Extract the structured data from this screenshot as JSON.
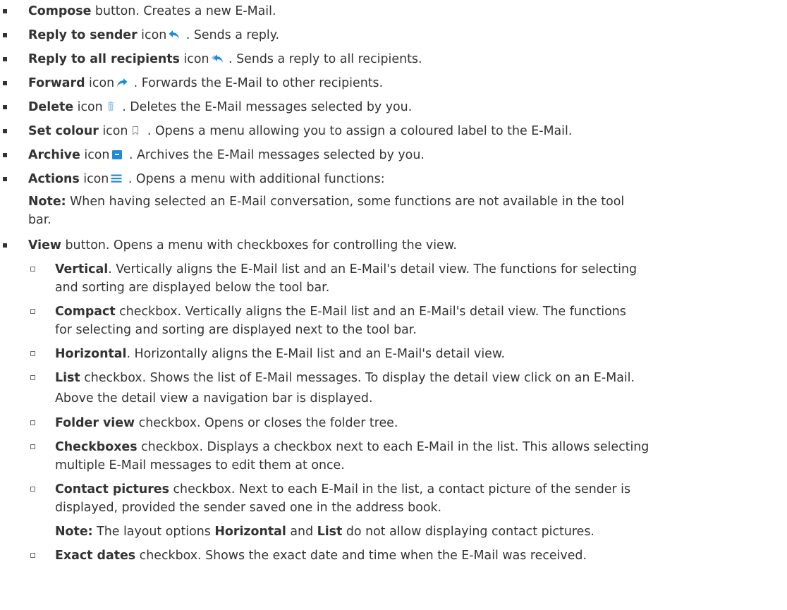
{
  "items": [
    {
      "bold": "Compose",
      "rest": " button. Creates a new E-Mail."
    },
    {
      "bold": "Reply to sender",
      "pre": " icon",
      "icon": "reply-icon",
      "rest": " . Sends a reply."
    },
    {
      "bold": "Reply to all recipients",
      "pre": " icon",
      "icon": "reply-all-icon",
      "rest": " . Sends a reply to all recipients."
    },
    {
      "bold": "Forward",
      "pre": " icon",
      "icon": "forward-icon",
      "rest": " . Forwards the E-Mail to other recipients."
    },
    {
      "bold": "Delete",
      "pre": " icon",
      "icon": "trash-icon",
      "rest": " . Deletes the E-Mail messages selected by you."
    },
    {
      "bold": "Set colour",
      "pre": " icon",
      "icon": "bookmark-icon",
      "rest": " . Opens a menu allowing you to assign a coloured label to the E-Mail."
    },
    {
      "bold": "Archive",
      "pre": " icon",
      "icon": "archive-icon",
      "rest": " . Archives the E-Mail messages selected by you."
    },
    {
      "bold": "Actions",
      "pre": " icon",
      "icon": "menu-icon",
      "rest": " . Opens a menu with additional functions:"
    }
  ],
  "actions_note": {
    "label": "Note:",
    "line1": " When having selected an E-Mail conversation, some functions are not available in the tool",
    "line2": "bar."
  },
  "view": {
    "bold": "View",
    "rest": " button. Opens a menu with checkboxes for controlling the view."
  },
  "sub_items": [
    {
      "bold": "Vertical",
      "line1": ". Vertically aligns the E-Mail list and an E-Mail's detail view. The functions for selecting",
      "line2": "and sorting are displayed below the tool bar."
    },
    {
      "bold": "Compact",
      "line1": " checkbox. Vertically aligns the E-Mail list and an E-Mail's detail view. The functions",
      "line2": "for selecting and sorting are displayed next to the tool bar."
    },
    {
      "bold": "Horizontal",
      "line1": ". Horizontally aligns the E-Mail list and an E-Mail's detail view."
    },
    {
      "bold": "List",
      "line1": " checkbox. Shows the list of E-Mail messages. To display the detail view click on an E-Mail.",
      "line2": "Above the detail view a navigation bar is displayed."
    },
    {
      "bold": "Folder view",
      "line1": " checkbox. Opens or closes the folder tree."
    },
    {
      "bold": "Checkboxes",
      "line1": " checkbox. Displays a checkbox next to each E-Mail in the list. This allows selecting",
      "line2": "multiple E-Mail messages to edit them at once."
    },
    {
      "bold": "Contact pictures",
      "line1": " checkbox. Next to each E-Mail in the list, a contact picture of the sender is",
      "line2": "displayed, provided the sender saved one in the address book."
    },
    {
      "bold": "Exact dates",
      "line1": " checkbox. Shows the exact date and time when the E-Mail was received."
    }
  ],
  "pictures_note": {
    "label": "Note:",
    "t1": " The layout options ",
    "b1": "Horizontal",
    "t2": " and ",
    "b2": "List",
    "t3": " do not allow displaying contact pictures."
  },
  "colors": {
    "text": "#333333",
    "icon_blue": "#1f8ad8",
    "icon_light": "#9fc9ea",
    "icon_gray": "#8a8a8a"
  }
}
